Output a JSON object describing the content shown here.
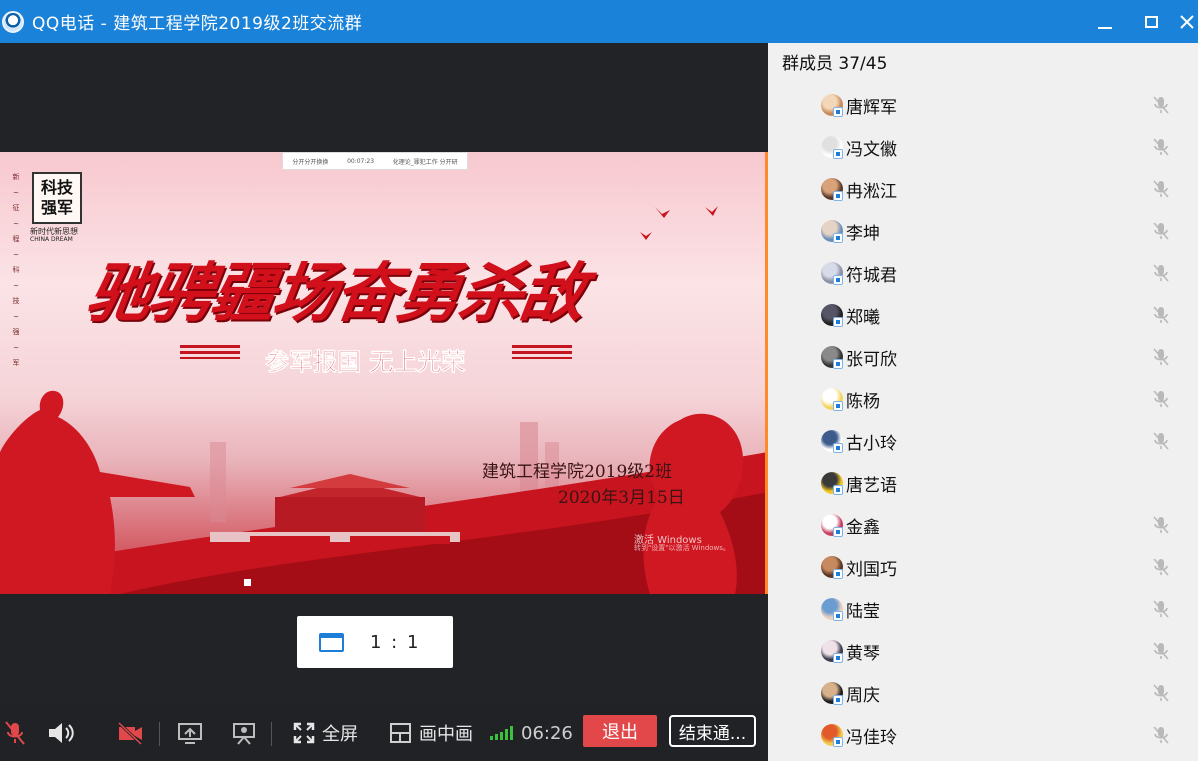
{
  "window": {
    "app": "QQ电话",
    "separator": " - ",
    "group": "建筑工程学院2019级2班交流群"
  },
  "slide": {
    "topbar_left": "分开分开换换",
    "topbar_mid": "00:07:23",
    "topbar_right": "化理论_罪犯工作 分开研",
    "vertical_slogan": "新~征~程~科~技~强~军",
    "badge": "科技强军",
    "badge_sub": "新时代新思想",
    "badge_sub2": "CHINA DREAM",
    "headline": "驰骋疆场奋勇杀敌",
    "subline": "参军报国 无上光荣",
    "class_name": "建筑工程学院2019级2班",
    "class_date": "2020年3月15日",
    "watermark1": "激活 Windows",
    "watermark2": "转到\"设置\"以激活 Windows。"
  },
  "ratio": {
    "label": "1 : 1",
    "icon": "window-icon"
  },
  "toolbar": {
    "fullscreen_label": "全屏",
    "pip_label": "画中画",
    "duration": "06:26",
    "exit_label": "退出",
    "end_label": "结束通...",
    "signal_level": 5,
    "signal_color": "#3cc13c"
  },
  "members": {
    "title": "群成员 37/45",
    "items": [
      {
        "name": "唐辉军",
        "muted": true
      },
      {
        "name": "冯文徽",
        "muted": true
      },
      {
        "name": "冉淞江",
        "muted": true
      },
      {
        "name": "李坤",
        "muted": true
      },
      {
        "name": "符城君",
        "muted": true
      },
      {
        "name": "郑曦",
        "muted": true
      },
      {
        "name": "张可欣",
        "muted": true
      },
      {
        "name": "陈杨",
        "muted": true
      },
      {
        "name": "古小玲",
        "muted": true
      },
      {
        "name": "唐艺语",
        "muted": false
      },
      {
        "name": "金鑫",
        "muted": true
      },
      {
        "name": "刘国巧",
        "muted": true
      },
      {
        "name": "陆莹",
        "muted": true
      },
      {
        "name": "黄琴",
        "muted": true
      },
      {
        "name": "周庆",
        "muted": true
      },
      {
        "name": "冯佳玲",
        "muted": true
      }
    ]
  },
  "colors": {
    "titlebar": "#1a82d8",
    "exit_button": "#e2484a",
    "panel_bg": "#f0f0f0",
    "muted_icon": "#b9b9b9"
  }
}
